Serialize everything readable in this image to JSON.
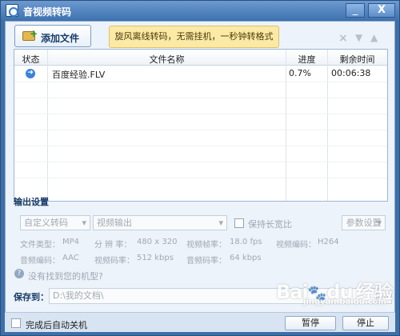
{
  "window": {
    "title": "音视频转码",
    "controls": [
      "_",
      "X"
    ]
  },
  "toolbar": {
    "add_file": "添加文件",
    "banner": "旋风离线转码，无需挂机，一秒钟转格式",
    "icons": [
      "delete-icon",
      "move-down-icon",
      "move-up-icon"
    ]
  },
  "table": {
    "headers": [
      "状态",
      "文件名称",
      "进度",
      "剩余时间"
    ],
    "rows": [
      {
        "status_icon": "play-arrow-icon",
        "name": "百度经验.FLV",
        "progress": "0.7%",
        "remaining": "00:06:38"
      }
    ]
  },
  "output": {
    "section_title": "输出设置",
    "preset_select": "自定义转码",
    "mode_select": "视频输出",
    "keep_ratio": "保持长宽比",
    "params_button": "参数设置",
    "line1": {
      "type_label": "文件类型：",
      "type_value": "MP4",
      "resolution_label": "分 辨 率：",
      "resolution_value": "480 x 320",
      "framerate_label": "视频帧率：",
      "framerate_value": "18.0 fps",
      "vcodec_label": "视频编码：",
      "vcodec_value": "H264"
    },
    "line2": {
      "acodec_label": "音频编码：",
      "acodec_value": "AAC",
      "vbitrate_label": "视频码率：",
      "vbitrate_value": "512 kbps",
      "abitrate_label": "音频码率：",
      "abitrate_value": "64 kbps"
    },
    "help_link": "没有找到您的机型?"
  },
  "save": {
    "label": "保存到：",
    "path": "D:\\我的文档\\",
    "browse_icon": "folder-browse-icon"
  },
  "bottom": {
    "shutdown": "完成后自动关机",
    "pause": "暂停",
    "stop": "停止"
  },
  "watermark": {
    "brand": "Bai",
    "brand2": "du",
    "exp": "经验",
    "url": "jingyan.baidu.com"
  }
}
